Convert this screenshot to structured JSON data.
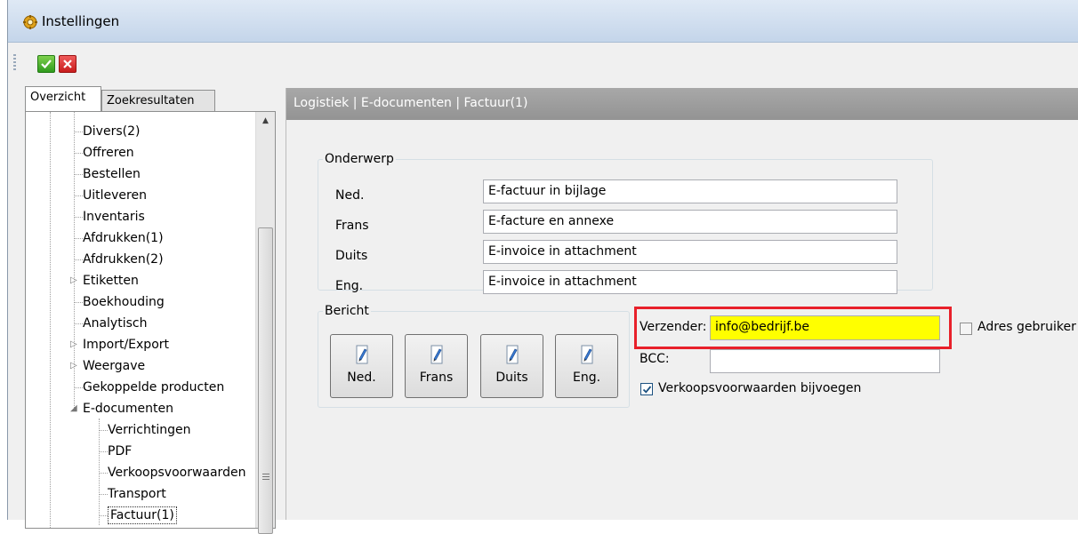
{
  "window": {
    "title": "Instellingen"
  },
  "toolbar": {
    "ok_icon": "check-icon",
    "cancel_icon": "close-icon"
  },
  "tabs": [
    {
      "label": "Overzicht",
      "active": true
    },
    {
      "label": "Zoekresultaten",
      "active": false
    }
  ],
  "tree": {
    "items": [
      {
        "label": "Divers(2)",
        "level": 1
      },
      {
        "label": "Offreren",
        "level": 1
      },
      {
        "label": "Bestellen",
        "level": 1
      },
      {
        "label": "Uitleveren",
        "level": 1
      },
      {
        "label": "Inventaris",
        "level": 1
      },
      {
        "label": "Afdrukken(1)",
        "level": 1
      },
      {
        "label": "Afdrukken(2)",
        "level": 1
      },
      {
        "label": "Etiketten",
        "level": 1,
        "expander": "collapsed"
      },
      {
        "label": "Boekhouding",
        "level": 1
      },
      {
        "label": "Analytisch",
        "level": 1
      },
      {
        "label": "Import/Export",
        "level": 1,
        "expander": "collapsed"
      },
      {
        "label": "Weergave",
        "level": 1,
        "expander": "collapsed"
      },
      {
        "label": "Gekoppelde producten",
        "level": 1
      },
      {
        "label": "E-documenten",
        "level": 1,
        "expander": "expanded"
      },
      {
        "label": "Verrichtingen",
        "level": 2
      },
      {
        "label": "PDF",
        "level": 2
      },
      {
        "label": "Verkoopsvoorwaarden",
        "level": 2
      },
      {
        "label": "Transport",
        "level": 2
      },
      {
        "label": "Factuur(1)",
        "level": 2,
        "selected": true
      }
    ]
  },
  "breadcrumb": "Logistiek | E-documenten | Factuur(1)",
  "onderwerp": {
    "legend": "Onderwerp",
    "rows": [
      {
        "label": "Ned.",
        "value": "E-factuur in bijlage"
      },
      {
        "label": "Frans",
        "value": "E-facture en annexe"
      },
      {
        "label": "Duits",
        "value": "E-invoice in attachment"
      },
      {
        "label": "Eng.",
        "value": "E-invoice in attachment"
      }
    ]
  },
  "bericht": {
    "legend": "Bericht",
    "buttons": [
      {
        "label": "Ned.",
        "icon": "pencil-icon"
      },
      {
        "label": "Frans",
        "icon": "pencil-icon"
      },
      {
        "label": "Duits",
        "icon": "pencil-icon"
      },
      {
        "label": "Eng.",
        "icon": "pencil-icon"
      }
    ]
  },
  "sender": {
    "label": "Verzender:",
    "value": "info@bedrijf.be",
    "highlight_color": "#ffff00",
    "box_color": "#e8202a"
  },
  "bcc": {
    "label": "BCC:",
    "value": ""
  },
  "adres_gebruiker": {
    "label": "Adres gebruiker",
    "checked": false
  },
  "verkoopsvoorwaarden": {
    "label": "Verkoopsvoorwaarden bijvoegen",
    "checked": true
  }
}
